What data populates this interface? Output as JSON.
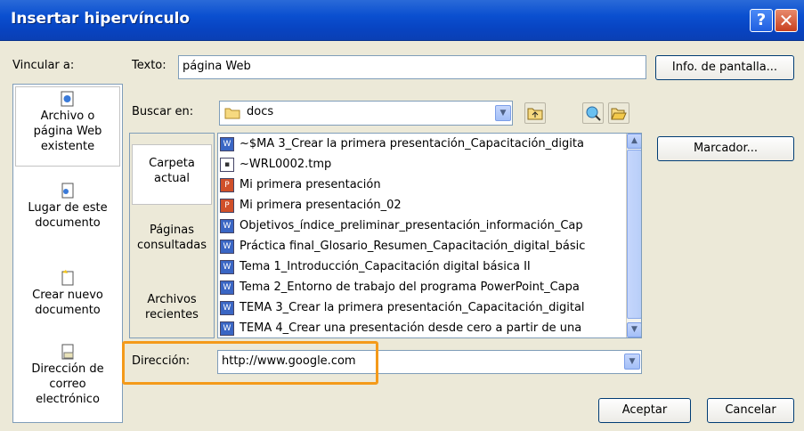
{
  "window": {
    "title": "Insertar hipervínculo",
    "help": "?",
    "close": "✕"
  },
  "vincular_label": "Vincular a:",
  "texto": {
    "label": "Texto:",
    "value": "página Web"
  },
  "info_button": "Info. de pantalla...",
  "buscar": {
    "label": "Buscar en:",
    "value": "docs"
  },
  "left_items": [
    {
      "line1": "Archivo o",
      "line2": "página Web",
      "line3": "existente",
      "icon": "web-page-icon"
    },
    {
      "line1": "Lugar de este",
      "line2": "documento",
      "line3": "",
      "icon": "place-in-document-icon"
    },
    {
      "line1": "Crear nuevo",
      "line2": "documento",
      "line3": "",
      "icon": "new-document-icon"
    },
    {
      "line1": "Dirección de",
      "line2": "correo",
      "line3": "electrónico",
      "icon": "email-icon"
    }
  ],
  "tabs": [
    {
      "line1": "Carpeta",
      "line2": "actual"
    },
    {
      "line1": "Páginas",
      "line2": "consultadas"
    },
    {
      "line1": "Archivos",
      "line2": "recientes"
    }
  ],
  "files": [
    {
      "name": "~$MA 3_Crear la primera presentación_Capacitación_digita",
      "type": "word"
    },
    {
      "name": "~WRL0002.tmp",
      "type": "tmp"
    },
    {
      "name": "Mi primera presentación",
      "type": "ppt"
    },
    {
      "name": "Mi primera presentación_02",
      "type": "ppt"
    },
    {
      "name": "Objetivos_índice_preliminar_presentación_información_Cap",
      "type": "word"
    },
    {
      "name": "Práctica final_Glosario_Resumen_Capacitación_digital_básic",
      "type": "word"
    },
    {
      "name": "Tema 1_Introducción_Capacitación digital básica II",
      "type": "word"
    },
    {
      "name": "Tema 2_Entorno de trabajo del programa PowerPoint_Capa",
      "type": "word"
    },
    {
      "name": "TEMA 3_Crear la primera presentación_Capacitación_digital",
      "type": "word"
    },
    {
      "name": "TEMA 4_Crear una presentación desde cero a partir de una",
      "type": "word"
    }
  ],
  "marcador_button": "Marcador...",
  "direccion": {
    "label": "Dirección:",
    "value": "http://www.google.com"
  },
  "accept_button": "Aceptar",
  "cancel_button": "Cancelar"
}
